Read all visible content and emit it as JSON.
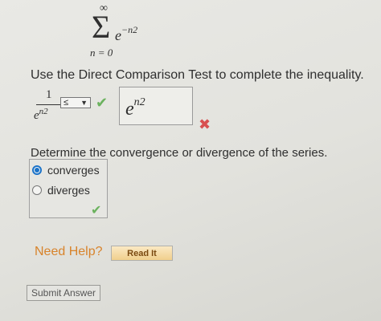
{
  "series_expression": {
    "upper_limit": "∞",
    "sigma": "Σ",
    "lower_limit": "n = 0",
    "term_base": "e",
    "term_exponent": "−n2"
  },
  "instruction": "Use the Direct Comparison Test to complete the inequality.",
  "inequality": {
    "lhs_numerator": "1",
    "lhs_denominator_base": "e",
    "lhs_denominator_exponent": "n2",
    "selected_relation": "≤",
    "relation_status": "correct",
    "answer_base": "e",
    "answer_exponent": "n2",
    "answer_status": "incorrect"
  },
  "question": "Determine the convergence or divergence of the series.",
  "options": [
    {
      "label": "converges",
      "selected": true
    },
    {
      "label": "diverges",
      "selected": false
    }
  ],
  "options_status": "correct",
  "help": {
    "need_help_label": "Need Help?",
    "read_it_label": "Read It"
  },
  "submit_label": "Submit Answer",
  "colors": {
    "correct": "#6bb25e",
    "incorrect": "#d85050",
    "selected_radio": "#1b73c9",
    "need_help": "#d8832b"
  }
}
